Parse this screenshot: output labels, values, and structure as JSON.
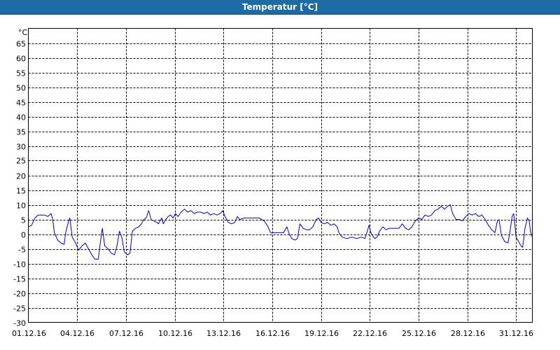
{
  "window": {
    "title": "Temperatur [°C]"
  },
  "chart_data": {
    "type": "line",
    "title": "Temperatur [°C]",
    "ylabel": "°C",
    "xlabel": "",
    "ylim": [
      -30,
      70
    ],
    "y_ticks": [
      65,
      60,
      55,
      50,
      45,
      40,
      35,
      30,
      25,
      20,
      15,
      10,
      5,
      0,
      -5,
      -10,
      -15,
      -20,
      -25,
      -30
    ],
    "x_range_days": [
      1,
      32
    ],
    "x_ticks": [
      {
        "day": 1,
        "label": "01.12.16"
      },
      {
        "day": 4,
        "label": "04.12.16"
      },
      {
        "day": 7,
        "label": "07.12.16"
      },
      {
        "day": 10,
        "label": "10.12.16"
      },
      {
        "day": 13,
        "label": "13.12.16"
      },
      {
        "day": 16,
        "label": "16.12.16"
      },
      {
        "day": 19,
        "label": "19.12.16"
      },
      {
        "day": 22,
        "label": "22.12.16"
      },
      {
        "day": 25,
        "label": "25.12.16"
      },
      {
        "day": 28,
        "label": "28.12.16"
      },
      {
        "day": 31,
        "label": "31.12.16"
      }
    ],
    "grid": true,
    "line_color": "#0000c0",
    "series": [
      {
        "values": [
          [
            1.0,
            2.5
          ],
          [
            1.2,
            3.0
          ],
          [
            1.4,
            5.5
          ],
          [
            1.6,
            6.5
          ],
          [
            1.8,
            6.5
          ],
          [
            2.0,
            6.5
          ],
          [
            2.2,
            6.0
          ],
          [
            2.4,
            7.0
          ],
          [
            2.5,
            5.0
          ],
          [
            2.6,
            0.5
          ],
          [
            2.8,
            -2.0
          ],
          [
            3.0,
            -3.0
          ],
          [
            3.2,
            -3.5
          ],
          [
            3.3,
            0.5
          ],
          [
            3.45,
            4.0
          ],
          [
            3.55,
            5.5
          ],
          [
            3.7,
            -1.0
          ],
          [
            3.9,
            -3.0
          ],
          [
            4.1,
            -5.5
          ],
          [
            4.3,
            -4.0
          ],
          [
            4.5,
            -3.0
          ],
          [
            4.7,
            -5.0
          ],
          [
            4.9,
            -7.0
          ],
          [
            5.1,
            -8.5
          ],
          [
            5.3,
            -8.5
          ],
          [
            5.4,
            -4.0
          ],
          [
            5.55,
            2.0
          ],
          [
            5.7,
            -4.0
          ],
          [
            5.9,
            -5.0
          ],
          [
            6.1,
            -6.5
          ],
          [
            6.3,
            -7.0
          ],
          [
            6.45,
            -4.0
          ],
          [
            6.6,
            1.0
          ],
          [
            6.75,
            -1.0
          ],
          [
            6.9,
            -6.0
          ],
          [
            7.1,
            -7.0
          ],
          [
            7.25,
            -6.5
          ],
          [
            7.4,
            1.0
          ],
          [
            7.6,
            2.0
          ],
          [
            7.8,
            2.5
          ],
          [
            7.95,
            3.5
          ],
          [
            8.1,
            5.0
          ],
          [
            8.25,
            5.5
          ],
          [
            8.4,
            8.0
          ],
          [
            8.55,
            5.0
          ],
          [
            8.7,
            4.5
          ],
          [
            8.9,
            4.0
          ],
          [
            9.0,
            3.5
          ],
          [
            9.2,
            5.5
          ],
          [
            9.3,
            3.5
          ],
          [
            9.45,
            5.0
          ],
          [
            9.6,
            6.0
          ],
          [
            9.75,
            6.5
          ],
          [
            9.9,
            5.5
          ],
          [
            10.05,
            7.0
          ],
          [
            10.2,
            6.0
          ],
          [
            10.4,
            7.5
          ],
          [
            10.6,
            8.5
          ],
          [
            10.8,
            7.5
          ],
          [
            11.0,
            8.0
          ],
          [
            11.2,
            7.0
          ],
          [
            11.4,
            7.5
          ],
          [
            11.6,
            7.5
          ],
          [
            11.8,
            7.0
          ],
          [
            12.0,
            7.5
          ],
          [
            12.2,
            6.5
          ],
          [
            12.4,
            7.0
          ],
          [
            12.6,
            6.5
          ],
          [
            12.8,
            7.0
          ],
          [
            12.95,
            8.0
          ],
          [
            13.1,
            6.0
          ],
          [
            13.3,
            4.0
          ],
          [
            13.5,
            3.5
          ],
          [
            13.7,
            4.0
          ],
          [
            13.85,
            6.0
          ],
          [
            14.0,
            5.0
          ],
          [
            14.3,
            5.5
          ],
          [
            14.6,
            5.5
          ],
          [
            14.9,
            5.5
          ],
          [
            15.2,
            5.5
          ],
          [
            15.5,
            4.5
          ],
          [
            15.7,
            3.0
          ],
          [
            15.9,
            0.5
          ],
          [
            16.1,
            0.5
          ],
          [
            16.4,
            0.5
          ],
          [
            16.7,
            0.5
          ],
          [
            16.9,
            2.5
          ],
          [
            17.05,
            0.0
          ],
          [
            17.2,
            -1.5
          ],
          [
            17.4,
            -2.0
          ],
          [
            17.55,
            -1.5
          ],
          [
            17.7,
            3.5
          ],
          [
            17.9,
            2.0
          ],
          [
            18.1,
            1.5
          ],
          [
            18.3,
            1.5
          ],
          [
            18.5,
            2.5
          ],
          [
            18.7,
            5.0
          ],
          [
            18.85,
            5.5
          ],
          [
            19.0,
            4.0
          ],
          [
            19.2,
            3.5
          ],
          [
            19.4,
            4.0
          ],
          [
            19.6,
            3.0
          ],
          [
            19.8,
            3.5
          ],
          [
            20.0,
            2.5
          ],
          [
            20.1,
            0.5
          ],
          [
            20.3,
            -1.0
          ],
          [
            20.6,
            -1.5
          ],
          [
            20.9,
            -1.0
          ],
          [
            21.2,
            -1.5
          ],
          [
            21.5,
            -1.0
          ],
          [
            21.7,
            -1.5
          ],
          [
            21.85,
            1.0
          ],
          [
            21.95,
            3.0
          ],
          [
            22.1,
            0.0
          ],
          [
            22.3,
            -1.5
          ],
          [
            22.45,
            -1.0
          ],
          [
            22.6,
            1.0
          ],
          [
            22.8,
            2.5
          ],
          [
            23.0,
            1.5
          ],
          [
            23.2,
            2.0
          ],
          [
            23.4,
            2.0
          ],
          [
            23.6,
            2.0
          ],
          [
            23.8,
            2.0
          ],
          [
            24.0,
            3.5
          ],
          [
            24.2,
            2.0
          ],
          [
            24.4,
            1.5
          ],
          [
            24.6,
            2.5
          ],
          [
            24.8,
            4.5
          ],
          [
            25.0,
            5.5
          ],
          [
            25.2,
            5.0
          ],
          [
            25.4,
            6.5
          ],
          [
            25.6,
            6.0
          ],
          [
            25.8,
            6.5
          ],
          [
            26.0,
            8.0
          ],
          [
            26.2,
            8.5
          ],
          [
            26.4,
            9.5
          ],
          [
            26.6,
            8.5
          ],
          [
            26.8,
            9.5
          ],
          [
            26.95,
            10.0
          ],
          [
            27.1,
            7.0
          ],
          [
            27.3,
            5.0
          ],
          [
            27.5,
            5.0
          ],
          [
            27.7,
            4.5
          ],
          [
            27.9,
            6.0
          ],
          [
            28.1,
            7.0
          ],
          [
            28.3,
            6.5
          ],
          [
            28.5,
            7.0
          ],
          [
            28.7,
            6.0
          ],
          [
            28.9,
            6.5
          ],
          [
            29.1,
            5.0
          ],
          [
            29.3,
            3.0
          ],
          [
            29.5,
            1.5
          ],
          [
            29.7,
            0.5
          ],
          [
            29.85,
            4.5
          ],
          [
            29.95,
            5.0
          ],
          [
            30.1,
            -0.5
          ],
          [
            30.3,
            -2.5
          ],
          [
            30.5,
            -3.0
          ],
          [
            30.6,
            0.0
          ],
          [
            30.75,
            6.0
          ],
          [
            30.85,
            7.0
          ],
          [
            31.0,
            -1.0
          ],
          [
            31.15,
            -2.5
          ],
          [
            31.3,
            -4.0
          ],
          [
            31.4,
            -4.5
          ],
          [
            31.55,
            2.0
          ],
          [
            31.7,
            5.5
          ],
          [
            31.8,
            4.5
          ],
          [
            31.9,
            0.5
          ],
          [
            32.0,
            -1.0
          ]
        ]
      }
    ]
  }
}
